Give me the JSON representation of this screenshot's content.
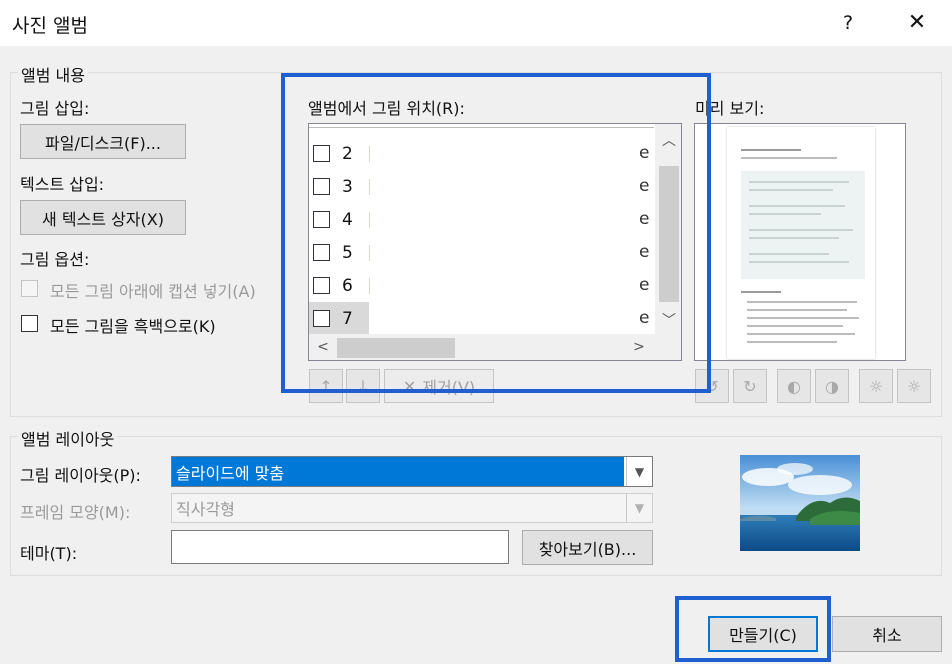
{
  "window": {
    "title": "사진 앨범",
    "help_glyph": "?",
    "close_glyph": "✕"
  },
  "album_content": {
    "legend": "앨범 내용",
    "insert_picture_label": "그림 삽입:",
    "file_disk_button": "파일/디스크(F)...",
    "insert_text_label": "텍스트 삽입:",
    "new_textbox_button": "새 텍스트 상자(X)",
    "picture_options_label": "그림 옵션:",
    "captions_checkbox": "모든 그림 아래에 캡션 넣기(A)",
    "black_white_checkbox": "모든 그림을 흑백으로(K)"
  },
  "album_list": {
    "label": "앨범에서 그림 위치(R):",
    "items": [
      {
        "number": "2",
        "trail": "e"
      },
      {
        "number": "3",
        "trail": "e"
      },
      {
        "number": "4",
        "trail": "e"
      },
      {
        "number": "5",
        "trail": "e"
      },
      {
        "number": "6",
        "trail": "e"
      },
      {
        "number": "7",
        "trail": "e"
      }
    ],
    "remove_button": "제거(V)"
  },
  "preview": {
    "label": "미리 보기:"
  },
  "album_layout": {
    "legend": "앨범 레이아웃",
    "picture_layout_label": "그림 레이아웃(P):",
    "picture_layout_value": "슬라이드에 맞춤",
    "frame_shape_label": "프레임 모양(M):",
    "frame_shape_value": "직사각형",
    "theme_label": "테마(T):",
    "theme_value": "",
    "browse_button": "찾아보기(B)..."
  },
  "footer": {
    "create_button": "만들기(C)",
    "cancel_button": "취소"
  },
  "colors": {
    "accent_highlight": "#1f5fd1",
    "selection": "#0078d7"
  }
}
